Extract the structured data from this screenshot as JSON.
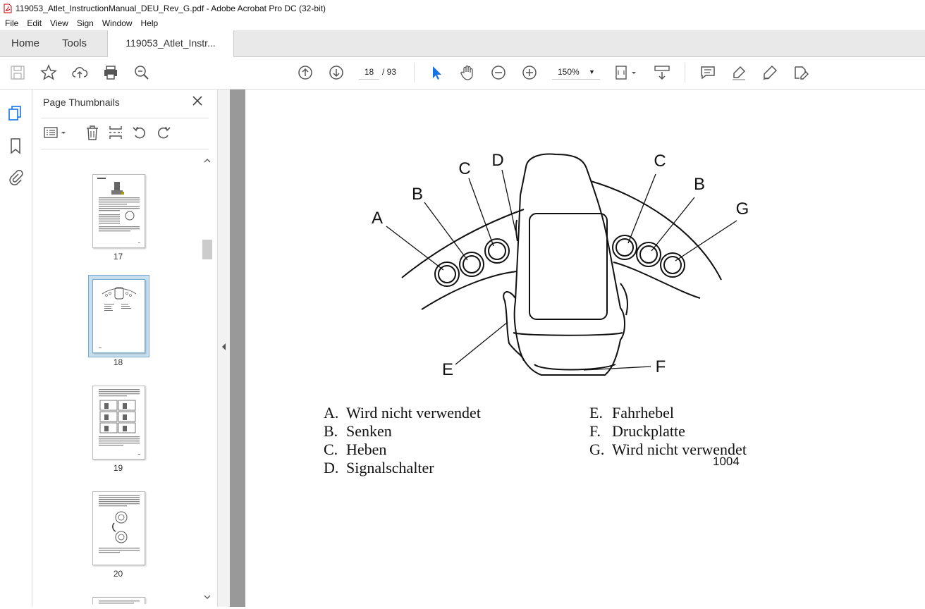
{
  "window": {
    "title": "119053_Atlet_InstructionManual_DEU_Rev_G.pdf - Adobe Acrobat Pro DC (32-bit)"
  },
  "menu": [
    "File",
    "Edit",
    "View",
    "Sign",
    "Window",
    "Help"
  ],
  "tabs": {
    "home": "Home",
    "tools": "Tools",
    "doc": "119053_Atlet_Instr..."
  },
  "nav": {
    "current_page": "18",
    "total": "/ 93",
    "zoom": "150%"
  },
  "panel": {
    "title": "Page Thumbnails",
    "thumbnails": [
      {
        "label": "17"
      },
      {
        "label": "18",
        "selected": true
      },
      {
        "label": "19"
      },
      {
        "label": "20"
      }
    ]
  },
  "figure": {
    "callouts": [
      "A",
      "B",
      "C",
      "D",
      "C",
      "B",
      "G",
      "E",
      "F"
    ],
    "number": "1004"
  },
  "legend": {
    "left": [
      {
        "key": "A.",
        "text": "Wird nicht verwendet"
      },
      {
        "key": "B.",
        "text": "Senken"
      },
      {
        "key": "C.",
        "text": "Heben"
      },
      {
        "key": "D.",
        "text": "Signalschalter"
      }
    ],
    "right": [
      {
        "key": "E.",
        "text": "Fahrhebel"
      },
      {
        "key": "F.",
        "text": "Druckplatte"
      },
      {
        "key": "G.",
        "text": "Wird nicht verwendet"
      }
    ]
  }
}
